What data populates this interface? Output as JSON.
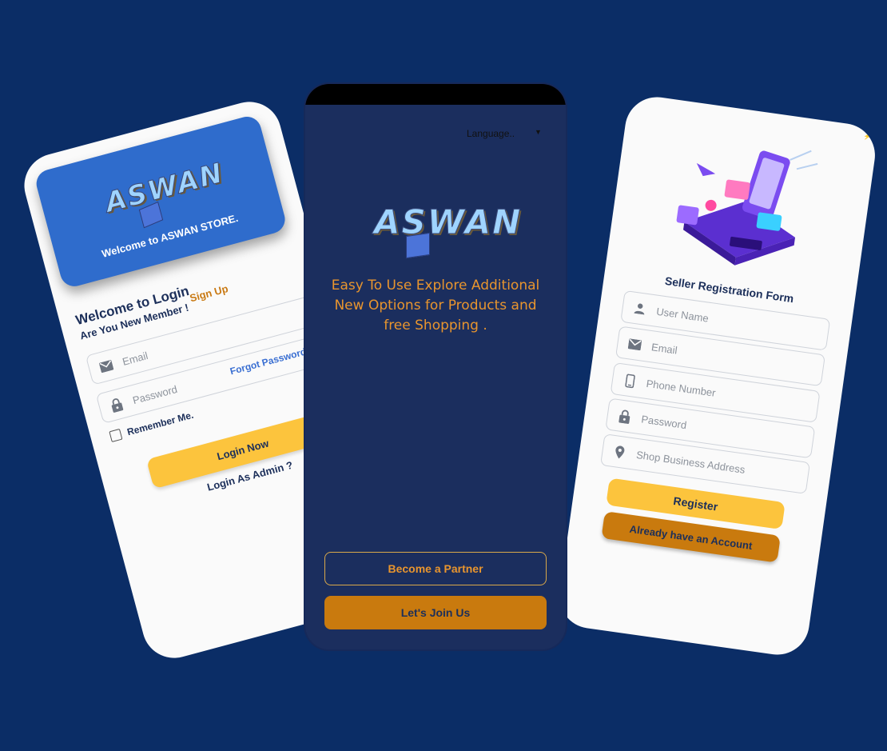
{
  "login_screen": {
    "logo_text": "ASWAN",
    "welcome_banner": "Welcome to ASWAN STORE.",
    "title": "Welcome to Login",
    "new_member_text": "Are You New Member !",
    "sign_up_link": "Sign Up",
    "email_placeholder": "Email",
    "password_placeholder": "Password",
    "forgot_password_link": "Forgot Password?",
    "remember_me_label": "Remember Me.",
    "login_button": "Login Now",
    "admin_link": "Login As Admin ?"
  },
  "welcome_screen": {
    "language_selector": "Language..",
    "logo_text": "ASWAN",
    "tagline": "Easy To Use Explore Additional New Options for Products and free Shopping .",
    "partner_button": "Become a Partner",
    "join_button": "Let's Join Us"
  },
  "registration_screen": {
    "form_title": "Seller Registration Form",
    "username_placeholder": "User Name",
    "email_placeholder": "Email",
    "phone_placeholder": "Phone Number",
    "password_placeholder": "Password",
    "address_placeholder": "Shop Business Address",
    "register_button": "Register",
    "account_button": "Already have an Account"
  },
  "icons": {
    "email": "envelope-icon",
    "password": "lock-icon",
    "user": "person-icon",
    "phone": "phone-icon",
    "address": "location-pin-icon"
  },
  "colors": {
    "background": "#0b2d66",
    "center_phone": "#1b2e5e",
    "accent_yellow": "#fcc43d",
    "accent_orange": "#c97a0e",
    "banner_blue": "#2f6ccc",
    "link_blue": "#3a6fd2",
    "text_dark": "#1c2f5a"
  }
}
